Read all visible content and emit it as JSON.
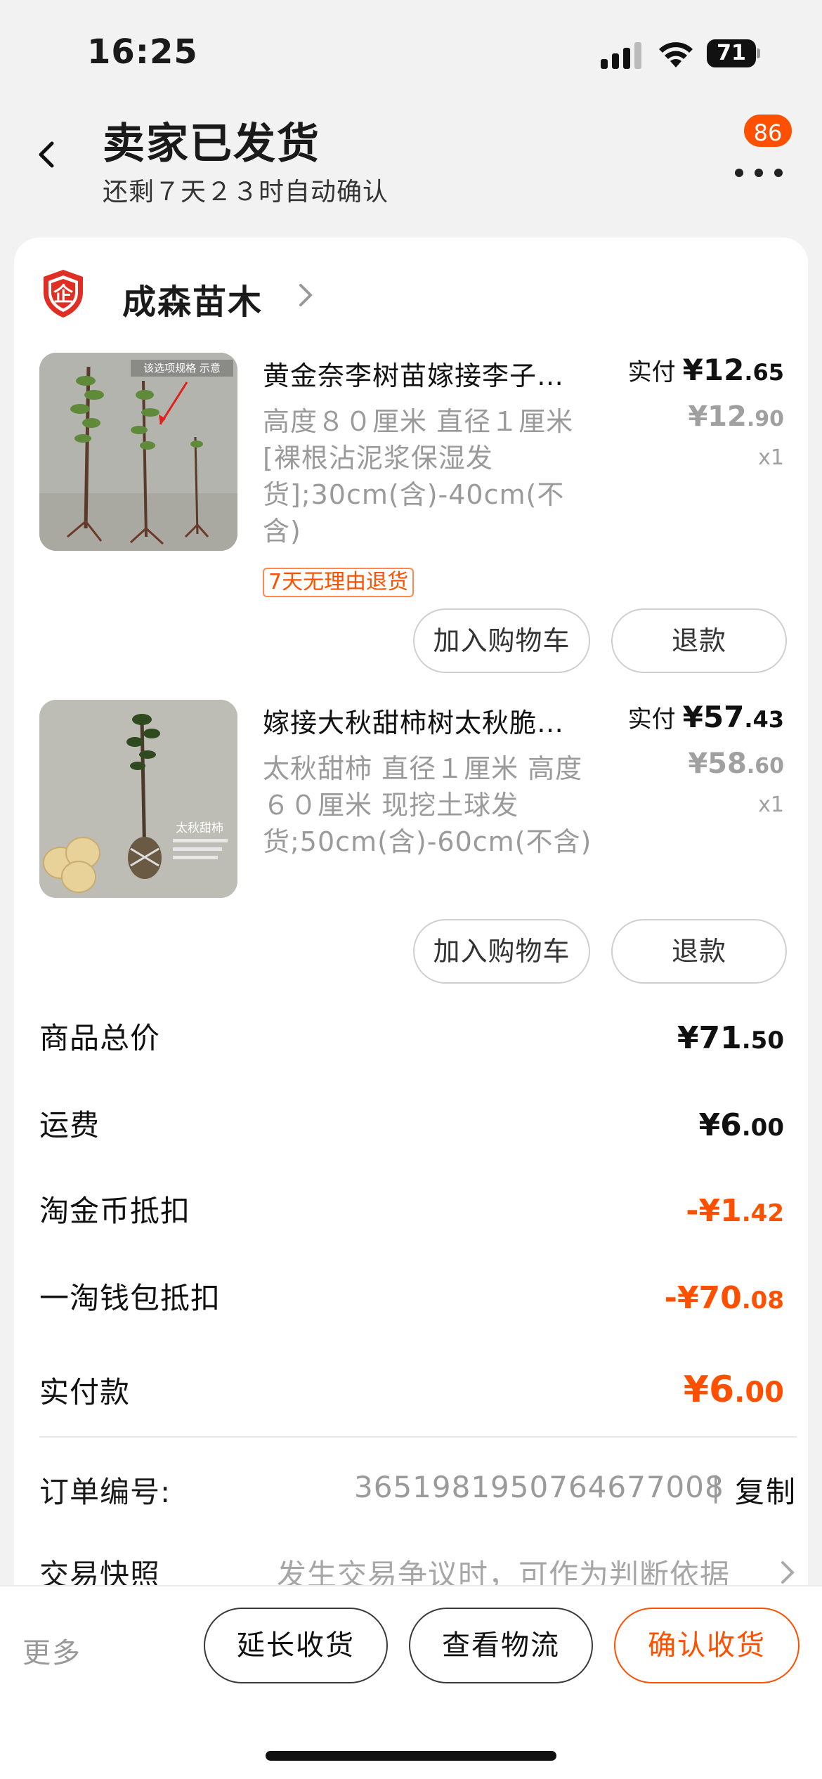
{
  "status_bar": {
    "time": "16:25",
    "battery": "71",
    "icons": [
      "signal-icon",
      "wifi-icon",
      "battery-icon"
    ]
  },
  "header": {
    "title": "卖家已发货",
    "subtitle": "还剩７天２３时自动确认",
    "more_badge": "86",
    "icons": [
      "back-icon",
      "more-icon"
    ]
  },
  "shop": {
    "name": "成森苗木",
    "badge_char": "企",
    "icons": [
      "enterprise-shield-icon",
      "chevron-right-icon"
    ]
  },
  "items": [
    {
      "title": "黄金奈李树苗嫁接李子…",
      "spec": "高度８０厘米 直径１厘米 [裸根沾泥浆保湿发货];30cm(含)-40cm(不含)",
      "paid_label": "实付",
      "paid_int": "¥12",
      "paid_dec": ".65",
      "orig_int": "¥12",
      "orig_dec": ".90",
      "qty": "x1",
      "tag": "7天无理由退货",
      "thumb_caption": "该选项规格 示意",
      "add_cart": "加入购物车",
      "refund": "退款"
    },
    {
      "title": "嫁接大秋甜柿树太秋脆…",
      "spec": "太秋甜柿 直径１厘米 高度６０厘米 现挖土球发货;50cm(含)-60cm(不含)",
      "paid_label": "实付",
      "paid_int": "¥57",
      "paid_dec": ".43",
      "orig_int": "¥58",
      "orig_dec": ".60",
      "qty": "x1",
      "tag": "",
      "thumb_caption": "太秋甜柿",
      "add_cart": "加入购物车",
      "refund": "退款"
    }
  ],
  "summary": [
    {
      "label": "商品总价",
      "int": "¥71",
      "dec": ".50",
      "highlight": false
    },
    {
      "label": "运费",
      "int": "¥6",
      "dec": ".00",
      "highlight": false
    },
    {
      "label": "淘金币抵扣",
      "int": "-¥1",
      "dec": ".42",
      "highlight": true
    },
    {
      "label": "一淘钱包抵扣",
      "int": "-¥70",
      "dec": ".08",
      "highlight": true
    },
    {
      "label": "实付款",
      "int": "¥6",
      "dec": ".00",
      "highlight": true
    }
  ],
  "order": {
    "number_label": "订单编号:",
    "number": "3651981950764677008",
    "separator": "|",
    "copy": "复制",
    "snapshot_label": "交易快照",
    "snapshot_desc": "发生交易争议时，可作为判断依据"
  },
  "bottom_bar": {
    "more": "更多",
    "extend": "延长收货",
    "logistics": "查看物流",
    "confirm": "确认收货"
  },
  "colors": {
    "accent": "#ff5000",
    "background": "#f2f2f2",
    "card": "#ffffff",
    "muted_text": "#9a9a9a"
  }
}
